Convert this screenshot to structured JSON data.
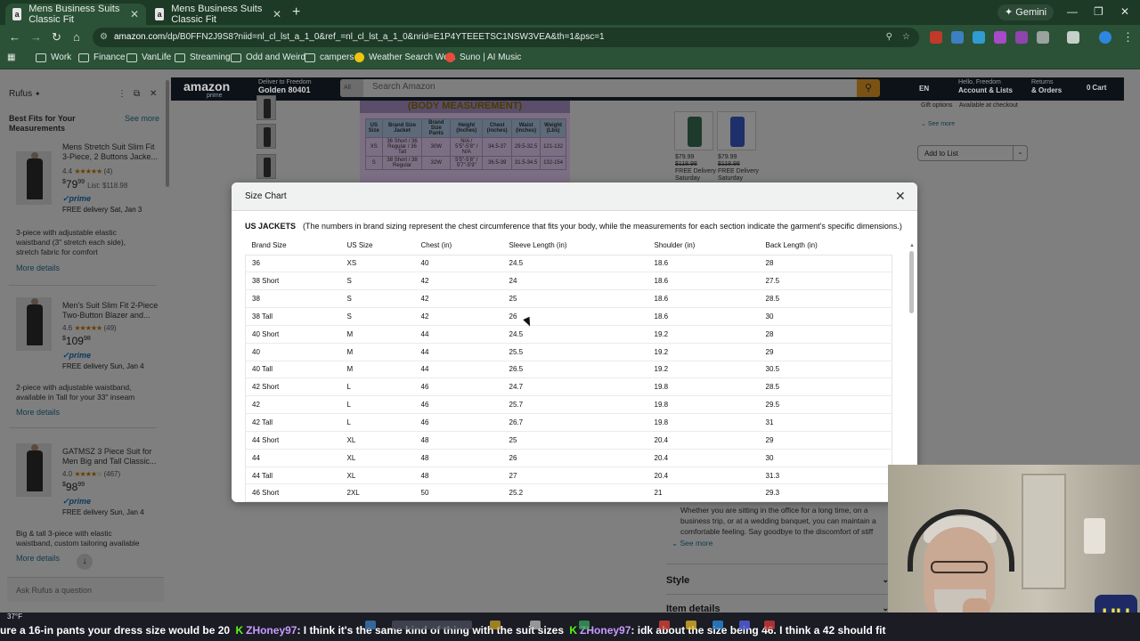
{
  "browser": {
    "tabs": [
      {
        "title": "Mens Business Suits Classic Fit",
        "active": true
      },
      {
        "title": "Mens Business Suits Classic Fit",
        "active": false
      }
    ],
    "gemini_label": "Gemini",
    "url_host": "amazon.com",
    "url_path": "/dp/B0FFN2J9S8?niid=nl_cl_lst_a_1_0&ref_=nl_cl_lst_a_1_0&nrid=E1P4YTEEETSC1NSW3VEA&th=1&psc=1",
    "bookmarks": [
      "Work",
      "Finance",
      "VanLife",
      "Streaming",
      "Odd and Weird",
      "campers",
      "Weather Search We...",
      "Suno | AI Music"
    ]
  },
  "amazon_header": {
    "logo": "amazon",
    "logo_sub": "prime",
    "deliver_line1": "Deliver to Freedom",
    "deliver_line2": "Golden 80401",
    "search_scope": "All",
    "search_placeholder": "Search Amazon",
    "lang": "EN",
    "account_line1": "Hello, Freedom",
    "account_line2": "Account & Lists",
    "returns_line1": "Returns",
    "returns_line2": "& Orders",
    "cart": "Cart",
    "cart_count": "0"
  },
  "rufus": {
    "title": "Rufus",
    "heading": "Best Fits for Your Measurements",
    "see_more": "See more",
    "products": [
      {
        "title": "Mens Stretch Suit Slim Fit 3-Piece, 2 Buttons Jacke...",
        "rating": "4.4",
        "reviews": "(4)",
        "price_whole": "79",
        "price_frac": "99",
        "list_price": "List: $118.98",
        "prime": "prime",
        "delivery": "FREE delivery Sat, Jan 3",
        "desc": "3-piece with adjustable elastic waistband (3\" stretch each side), stretch fabric for comfort",
        "more": "More details"
      },
      {
        "title": "Men's Suit Slim Fit 2-Piece Two-Button Blazer and...",
        "rating": "4.6",
        "reviews": "(49)",
        "price_whole": "109",
        "price_frac": "98",
        "list_price": "",
        "prime": "prime",
        "delivery": "FREE delivery Sun, Jan 4",
        "desc": "2-piece with adjustable waistband, available in Tall for your 33\" inseam",
        "more": "More details"
      },
      {
        "title": "GATMSZ 3 Piece Suit for Men Big and Tall Classic...",
        "rating": "4.0",
        "reviews": "(467)",
        "price_whole": "98",
        "price_frac": "99",
        "list_price": "",
        "prime": "prime",
        "delivery": "FREE delivery Sun, Jan 4",
        "desc": "Big & tall 3-piece with elastic waistband, custom tailoring available",
        "more": "More details"
      }
    ],
    "ask_placeholder": "Ask Rufus a question"
  },
  "background_page": {
    "measure_title": "(BODY MEASUREMENT)",
    "measure_headers": [
      "US Size",
      "Brand Size Jacket",
      "Brand Size Pants",
      "Height (Inches)",
      "Chest (inches)",
      "Waist (inches)",
      "Weight (Lbs)"
    ],
    "measure_rows": [
      [
        "XS",
        "36 Short / 36 Regular / 36 Tall",
        "30W",
        "N/A / 5'5\"-5'8\" / N/A",
        "34.5-37",
        "29.5-32.5",
        "121-132"
      ],
      [
        "S",
        "38 Short / 38 Regular",
        "32W",
        "5'5\"-5'8\" / 5'7\"-5'9\"",
        "36.5-39",
        "31.5-34.5",
        "132-154"
      ]
    ],
    "swatch_price_1": "$79.99",
    "swatch_list_1": "$118.98",
    "swatch_free_1": "FREE Delivery",
    "swatch_date_1": "Saturday",
    "swatch_price_2": "$79.99",
    "swatch_list_2": "$118.98",
    "swatch_free_2": "FREE Delivery",
    "swatch_date_2": "Saturday",
    "gift_options": "Gift options",
    "available_checkout": "Available at checkout",
    "see_more": "See more",
    "add_to_list": "Add to List",
    "description": "Whether you are sitting in the office for a long time, on a business trip, or at a wedding banquet, you can maintain a comfortable feeling. Say goodbye to the discomfort of stiff",
    "description_more": "See more",
    "style_label": "Style",
    "item_details_label": "Item details"
  },
  "size_chart": {
    "title": "Size Chart",
    "section_label": "US JACKETS",
    "section_note": "(The numbers in brand sizing represent the chest circumference that fits your body, while the measurements for each section indicate the garment's specific dimensions.)",
    "columns": [
      "Brand Size",
      "US Size",
      "Chest (in)",
      "Sleeve Length (in)",
      "Shoulder (in)",
      "Back Length (in)"
    ],
    "rows": [
      [
        "36",
        "XS",
        "40",
        "24.5",
        "18.6",
        "28"
      ],
      [
        "38 Short",
        "S",
        "42",
        "24",
        "18.6",
        "27.5"
      ],
      [
        "38",
        "S",
        "42",
        "25",
        "18.6",
        "28.5"
      ],
      [
        "38 Tall",
        "S",
        "42",
        "26",
        "18.6",
        "30"
      ],
      [
        "40 Short",
        "M",
        "44",
        "24.5",
        "19.2",
        "28"
      ],
      [
        "40",
        "M",
        "44",
        "25.5",
        "19.2",
        "29"
      ],
      [
        "40 Tall",
        "M",
        "44",
        "26.5",
        "19.2",
        "30.5"
      ],
      [
        "42 Short",
        "L",
        "46",
        "24.7",
        "19.8",
        "28.5"
      ],
      [
        "42",
        "L",
        "46",
        "25.7",
        "19.8",
        "29.5"
      ],
      [
        "42 Tall",
        "L",
        "46",
        "26.7",
        "19.8",
        "31"
      ],
      [
        "44 Short",
        "XL",
        "48",
        "25",
        "20.4",
        "29"
      ],
      [
        "44",
        "XL",
        "48",
        "26",
        "20.4",
        "30"
      ],
      [
        "44 Tall",
        "XL",
        "48",
        "27",
        "20.4",
        "31.3"
      ],
      [
        "46 Short",
        "2XL",
        "50",
        "25.2",
        "21",
        "29.3"
      ]
    ]
  },
  "stream": {
    "weather_temp": "37°F",
    "ticker": [
      {
        "type": "text",
        "value": "ure a 16-in pants your dress size would be 20"
      },
      {
        "type": "user",
        "value": "ZHoney97"
      },
      {
        "type": "text",
        "value": ": I think it's the same kind of thing with the suit sizes"
      },
      {
        "type": "user",
        "value": "ZHoney97"
      },
      {
        "type": "text",
        "value": ": idk about the size being 46. I think a 42 should fit"
      }
    ],
    "logo_text": "HU TV"
  },
  "colors": {
    "chrome_frame": "#1c3a25",
    "chrome_toolbar": "#2b5236",
    "amazon_dark": "#0d1218",
    "overlay_page": "#7f7f7f",
    "modal_bg": "#ffffff",
    "modal_header": "#f0f2f2",
    "link": "#007185",
    "prime_blue": "#0a7cc0",
    "kick_green": "#53fc18"
  },
  "icons": {
    "back": "arrow-left-icon",
    "forward": "arrow-right-icon",
    "reload": "reload-icon",
    "home": "home-icon",
    "star": "star-icon",
    "close": "close-icon",
    "search": "search-icon",
    "chevron": "chevron-down-icon"
  }
}
